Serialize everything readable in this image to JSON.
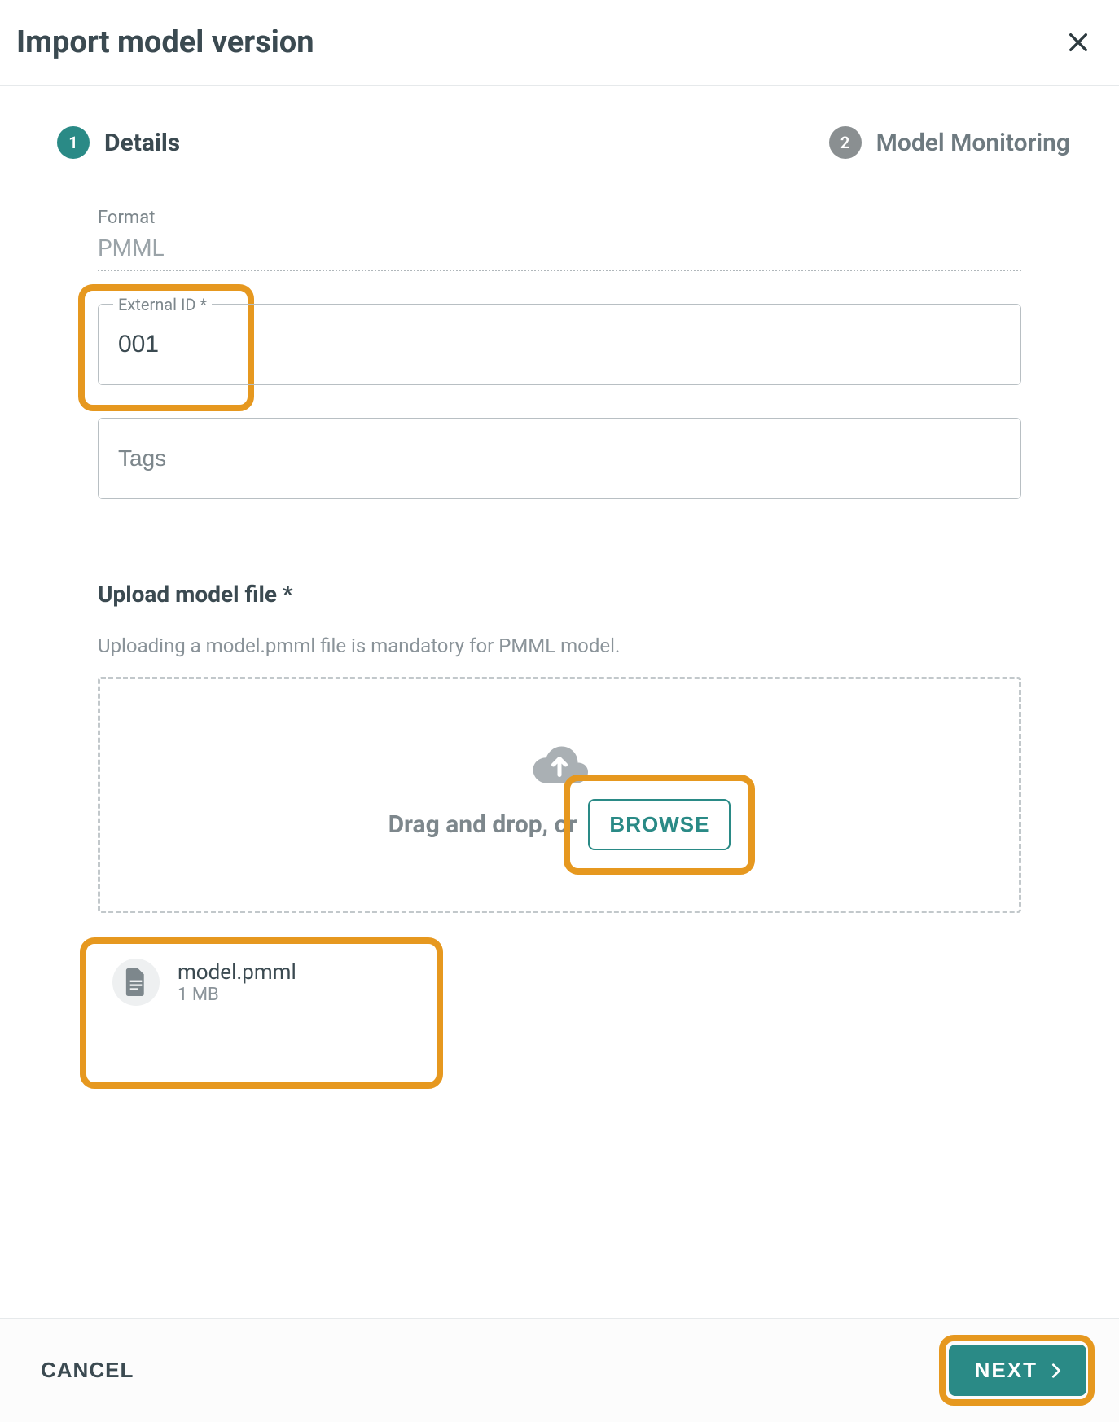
{
  "dialog": {
    "title": "Import model version"
  },
  "stepper": {
    "step1": {
      "num": "1",
      "label": "Details"
    },
    "step2": {
      "num": "2",
      "label": "Model Monitoring"
    }
  },
  "form": {
    "format_label": "Format",
    "format_value": "PMML",
    "external_id_label": "External ID *",
    "external_id_value": "001",
    "tags_placeholder": "Tags"
  },
  "upload": {
    "title": "Upload model file *",
    "hint": "Uploading a model.pmml file is mandatory for PMML model.",
    "drop_text": "Drag and drop, or",
    "browse_label": "BROWSE",
    "file": {
      "name": "model.pmml",
      "size": "1 MB"
    }
  },
  "footer": {
    "cancel": "CANCEL",
    "next": "NEXT"
  }
}
